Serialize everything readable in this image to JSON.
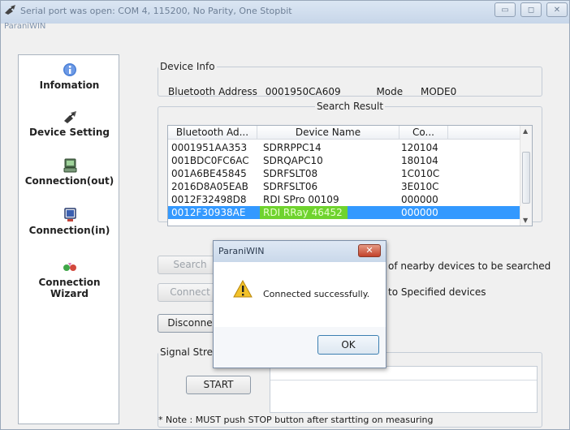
{
  "window": {
    "title": "Serial port was open: COM 4, 115200, No Parity, One Stopbit",
    "app_name": "ParaniWIN",
    "controls": [
      "minimize",
      "maximize",
      "close"
    ]
  },
  "sidebar": {
    "items": [
      {
        "label": "Infomation",
        "icon": "info-icon"
      },
      {
        "label": "Device Setting",
        "icon": "satellite-icon"
      },
      {
        "label": "Connection(out)",
        "icon": "computer-out-icon"
      },
      {
        "label": "Connection(in)",
        "icon": "computer-in-icon"
      },
      {
        "label": "Connection Wizard",
        "icon": "wizard-icon"
      }
    ]
  },
  "device_info": {
    "legend": "Device Info",
    "address_label": "Bluetooth Address",
    "address_value": "0001950CA609",
    "mode_label": "Mode",
    "mode_value": "MODE0"
  },
  "search_result": {
    "legend": "Search Result",
    "columns": [
      "Bluetooth Ad...",
      "Device Name",
      "Co..."
    ],
    "rows": [
      {
        "address": "0001951AA353",
        "name": "SDRRPPC14",
        "code": "120104"
      },
      {
        "address": "001BDC0FC6AC",
        "name": "SDRQAPC10",
        "code": "180104"
      },
      {
        "address": "001A6BE45845",
        "name": "SDRFSLT08",
        "code": "1C010C"
      },
      {
        "address": "2016D8A05EAB",
        "name": "SDRFSLT06",
        "code": "3E010C"
      },
      {
        "address": "0012F32498D8",
        "name": "RDI SPro 00109",
        "code": "000000"
      },
      {
        "address": "0012F30938AE",
        "name": "RDI RRay 46452",
        "code": "000000"
      }
    ],
    "selected_index": 5
  },
  "actions": {
    "search_label": "Search",
    "search_note": "of nearby devices to be searched",
    "connect_label": "Connect",
    "connect_note": "to Specified devices",
    "disconnect_label": "Disconne"
  },
  "signal": {
    "legend": "Signal Stre",
    "start_label": "START",
    "note": "* Note : MUST push STOP button after startting on measuring"
  },
  "dialog": {
    "title": "ParaniWIN",
    "close_glyph": "✕",
    "message": "Connected successfully.",
    "ok_label": "OK",
    "icon": "warning-icon"
  }
}
